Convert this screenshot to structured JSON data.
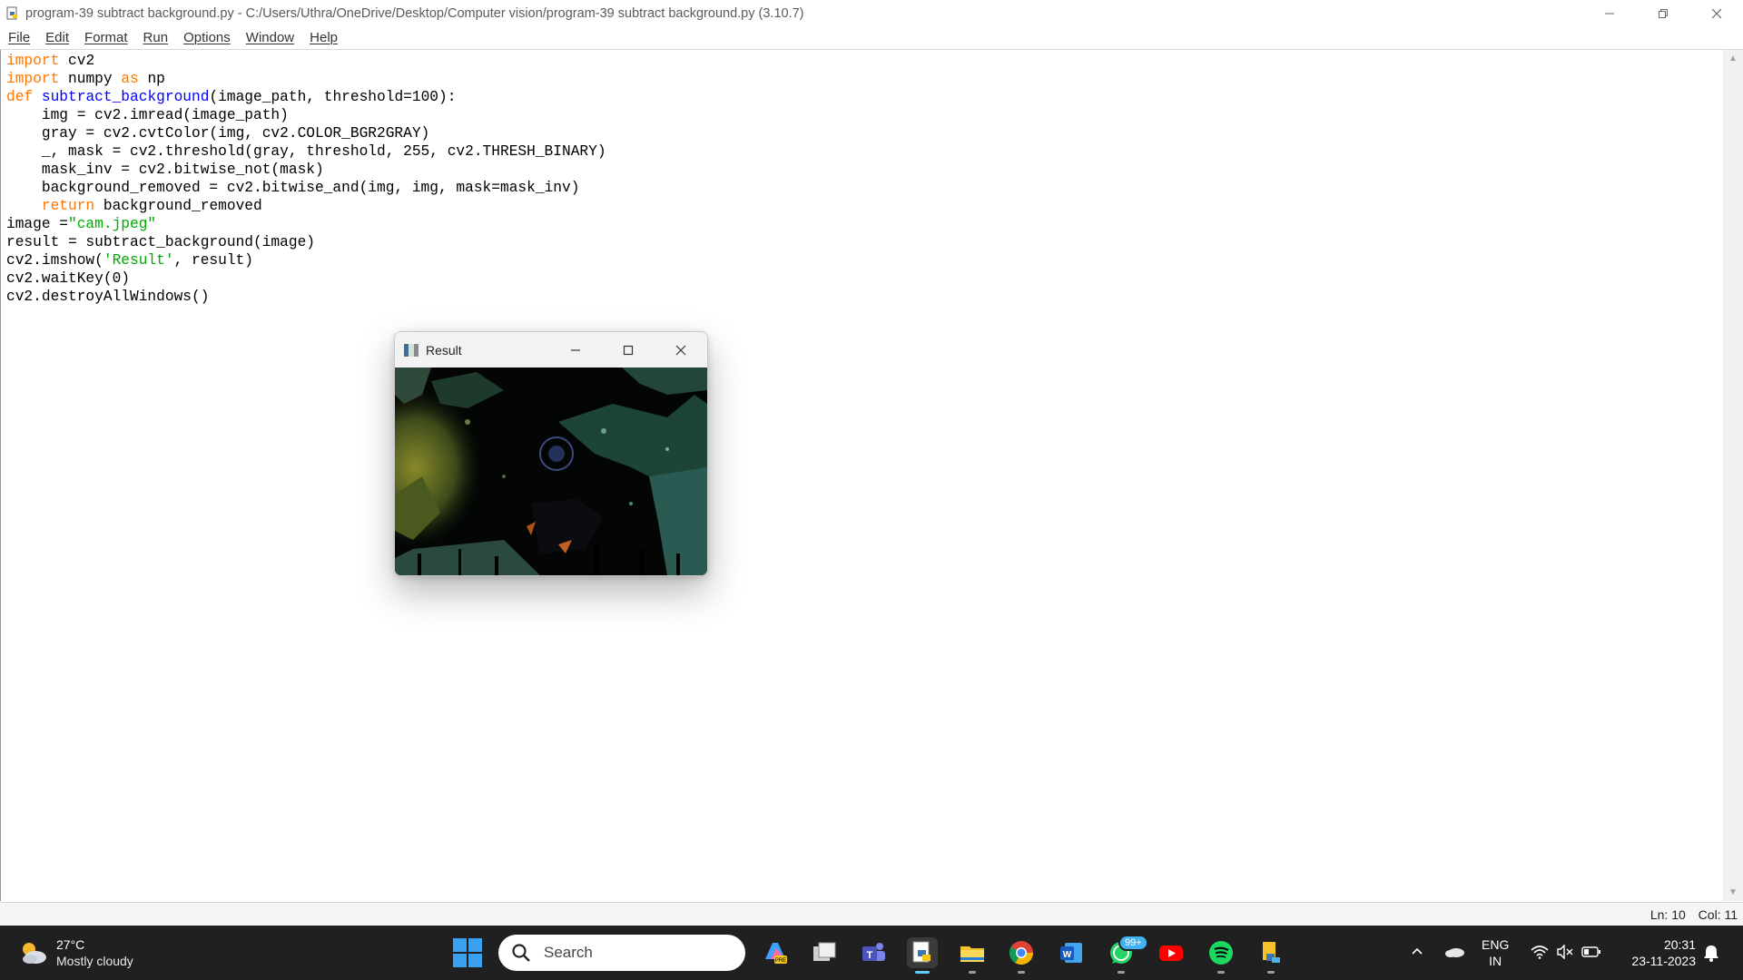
{
  "window": {
    "title": "program-39 subtract background.py - C:/Users/Uthra/OneDrive/Desktop/Computer vision/program-39 subtract background.py (3.10.7)",
    "controls": {
      "minimize": "—",
      "restore": "❐",
      "close": "✕"
    }
  },
  "menu": [
    "File",
    "Edit",
    "Format",
    "Run",
    "Options",
    "Window",
    "Help"
  ],
  "code_lines": [
    "import cv2",
    "import numpy as np",
    "def subtract_background(image_path, threshold=100):",
    "    img = cv2.imread(image_path)",
    "    gray = cv2.cvtColor(img, cv2.COLOR_BGR2GRAY)",
    "    _, mask = cv2.threshold(gray, threshold, 255, cv2.THRESH_BINARY)",
    "    mask_inv = cv2.bitwise_not(mask)",
    "    background_removed = cv2.bitwise_and(img, img, mask=mask_inv)",
    "    return background_removed",
    "image =\"cam.jpeg\"",
    "result = subtract_background(image)",
    "cv2.imshow('Result', result)",
    "cv2.waitKey(0)",
    "cv2.destroyAllWindows()"
  ],
  "syntax_colors": {
    "keyword": "#ff7700",
    "function": "#0000ff",
    "string": "#00aa00"
  },
  "status": {
    "line": "Ln: 10",
    "col": "Col: 11"
  },
  "result_window": {
    "title": "Result",
    "controls": {
      "minimize": "—",
      "maximize": "☐",
      "close": "✕"
    }
  },
  "taskbar": {
    "weather": {
      "temp": "27°C",
      "condition": "Mostly cloudy",
      "icon": "partly-cloudy-icon"
    },
    "search_label": "Search",
    "apps": [
      {
        "name": "copilot-pre-icon"
      },
      {
        "name": "task-view-icon"
      },
      {
        "name": "teams-icon"
      },
      {
        "name": "idle-python-icon"
      },
      {
        "name": "file-explorer-icon"
      },
      {
        "name": "chrome-icon"
      },
      {
        "name": "word-icon"
      },
      {
        "name": "whatsapp-icon"
      },
      {
        "name": "youtube-icon"
      },
      {
        "name": "spotify-icon"
      },
      {
        "name": "file-python-icon"
      }
    ],
    "whatsapp_badge": "99+",
    "lang_top": "ENG",
    "lang_bottom": "IN",
    "time": "20:31",
    "date": "23-11-2023"
  }
}
